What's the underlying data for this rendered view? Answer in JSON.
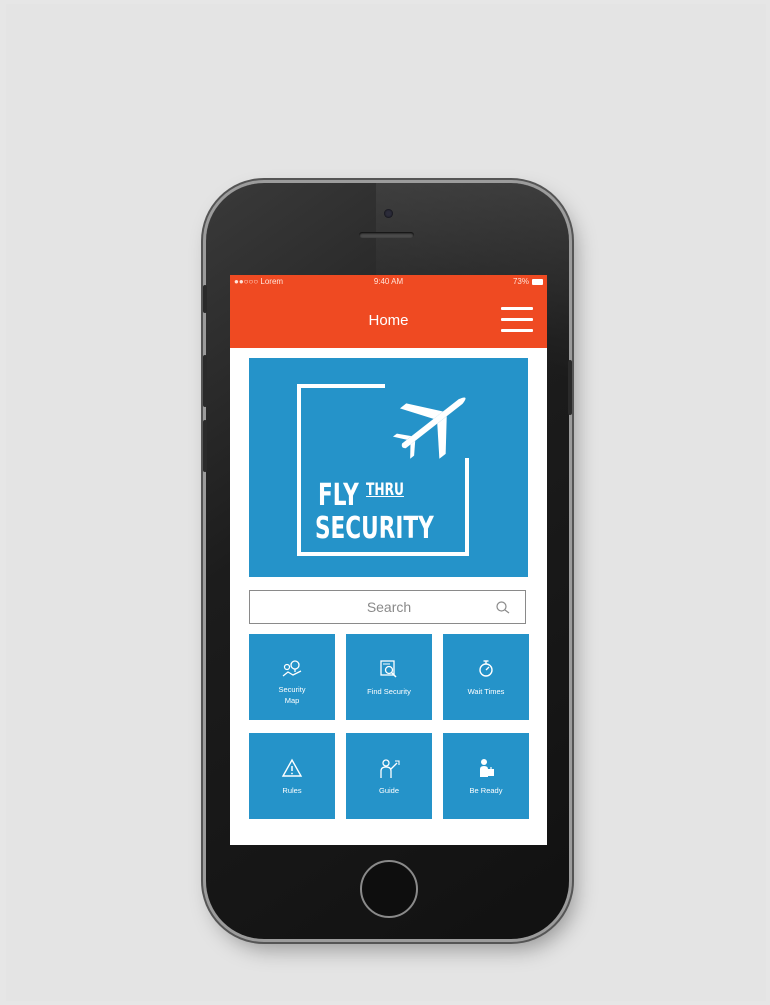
{
  "status_bar": {
    "carrier": "●●○○○ Lorem",
    "time": "9:40 AM",
    "battery": "73%"
  },
  "header": {
    "title": "Home"
  },
  "hero": {
    "logo_line1": "FLY",
    "logo_line1_small": "THRU",
    "logo_line2": "SECURITY"
  },
  "search": {
    "placeholder": "Search"
  },
  "tiles": [
    {
      "label": "Security\nMap",
      "icon": "map-pin-icon"
    },
    {
      "label": "Find Security",
      "icon": "find-security-icon"
    },
    {
      "label": "Wait Times",
      "icon": "stopwatch-icon"
    },
    {
      "label": "Rules",
      "icon": "warning-icon"
    },
    {
      "label": "Guide",
      "icon": "guide-person-icon"
    },
    {
      "label": "Be Ready",
      "icon": "traveler-icon"
    }
  ],
  "colors": {
    "accent": "#ef4a22",
    "tile_blue": "#2593c9"
  }
}
